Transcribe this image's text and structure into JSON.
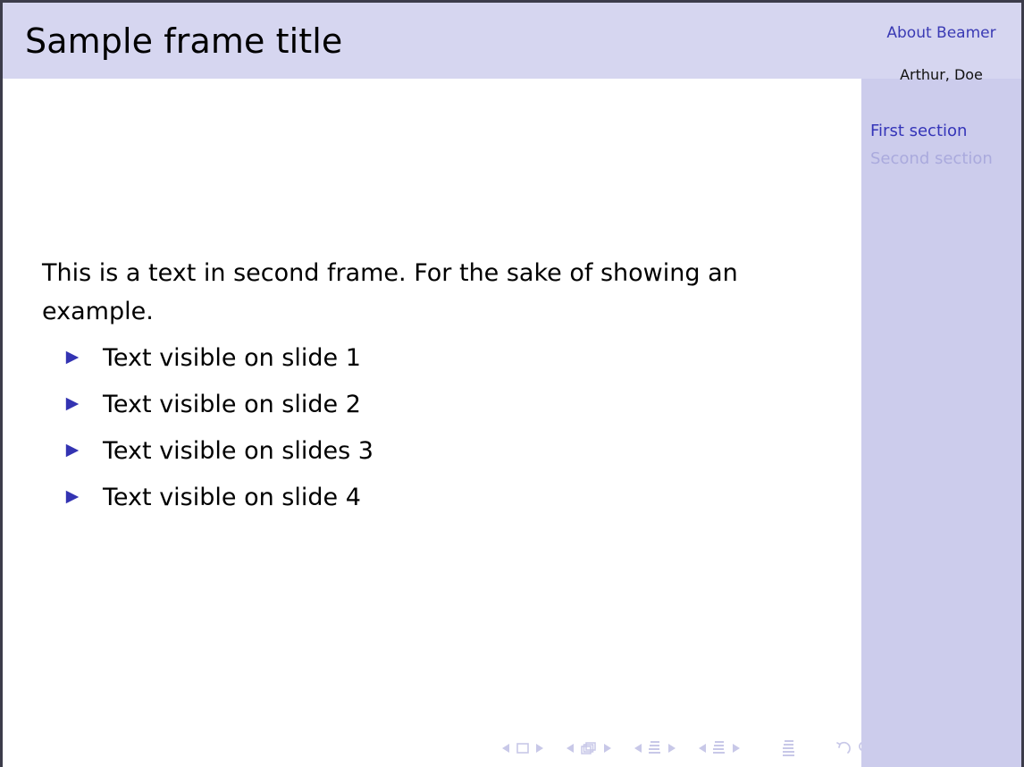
{
  "slide": {
    "frame_title": "Sample frame title",
    "body_paragraph": "This is a text in second frame. For the sake of showing an example.",
    "bullets": [
      {
        "marker": "triangle-right-icon",
        "text": "Text visible on slide 1"
      },
      {
        "marker": "triangle-right-icon",
        "text": "Text visible on slide 2"
      },
      {
        "marker": "triangle-right-icon",
        "text": "Text visible on slides 3"
      },
      {
        "marker": "triangle-right-icon",
        "text": "Text visible on slide 4"
      }
    ]
  },
  "sidebar": {
    "presentation_title": "About Beamer",
    "author": "Arthur, Doe",
    "sections": [
      {
        "label": "First section",
        "state": "active"
      },
      {
        "label": "Second section",
        "state": "inactive"
      }
    ]
  },
  "navigation": {
    "groups": [
      {
        "name": "slide-navigation",
        "buttons": [
          {
            "icon": "nav-prev-slide-icon"
          },
          {
            "icon": "nav-slide-icon"
          },
          {
            "icon": "nav-next-slide-icon"
          }
        ]
      },
      {
        "name": "frame-navigation",
        "buttons": [
          {
            "icon": "nav-prev-frame-icon"
          },
          {
            "icon": "nav-frame-icon"
          },
          {
            "icon": "nav-next-frame-icon"
          }
        ]
      },
      {
        "name": "subsection-navigation",
        "buttons": [
          {
            "icon": "nav-prev-subsection-icon"
          },
          {
            "icon": "nav-subsection-icon"
          },
          {
            "icon": "nav-next-subsection-icon"
          }
        ]
      },
      {
        "name": "section-navigation",
        "buttons": [
          {
            "icon": "nav-prev-section-icon"
          },
          {
            "icon": "nav-section-icon"
          },
          {
            "icon": "nav-next-section-icon"
          }
        ]
      },
      {
        "name": "presentation-navigation",
        "buttons": [
          {
            "icon": "nav-presentation-icon"
          }
        ]
      },
      {
        "name": "hyperlink-navigation",
        "buttons": [
          {
            "icon": "nav-back-icon"
          },
          {
            "icon": "nav-search-icon"
          },
          {
            "icon": "nav-forward-icon"
          }
        ]
      }
    ]
  },
  "colors": {
    "titlebar_bg": "#d6d6f0",
    "sidebar_bg": "#ccccec",
    "body_bg": "#ffffff",
    "accent_blue": "#3434b8",
    "inactive_blue": "#aaaadd",
    "nav_symbol": "#c8c8e8",
    "frame_border": "#3c3c4a"
  }
}
